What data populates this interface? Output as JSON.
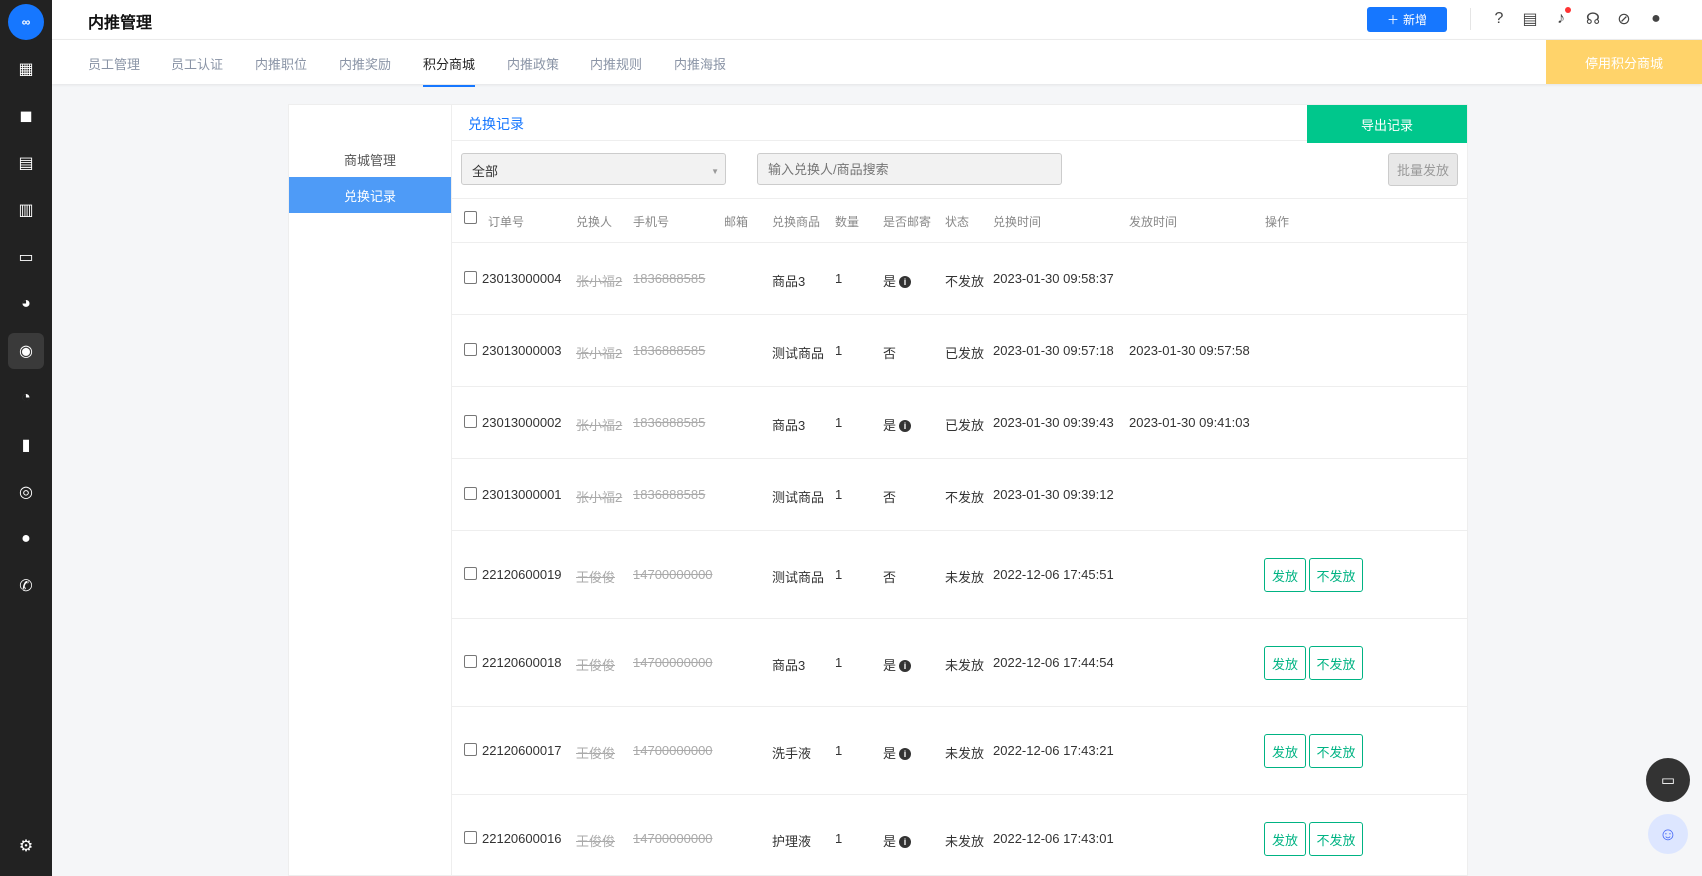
{
  "header": {
    "title": "内推管理",
    "new_label": "新增"
  },
  "tabs": [
    "员工管理",
    "员工认证",
    "内推职位",
    "内推奖励",
    "积分商城",
    "内推政策",
    "内推规则",
    "内推海报"
  ],
  "stop_label": "停用积分商城",
  "sidebar": {
    "items": [
      "商城管理",
      "兑换记录"
    ]
  },
  "panel": {
    "title": "兑换记录",
    "export_label": "导出记录",
    "filter_value": "全部",
    "search_placeholder": "输入兑换人/商品搜索",
    "batch_label": "批量发放"
  },
  "table": {
    "headers": [
      "订单号",
      "兑换人",
      "手机号",
      "邮箱",
      "兑换商品",
      "数量",
      "是否邮寄",
      "状态",
      "兑换时间",
      "发放时间",
      "操作"
    ],
    "rows": [
      {
        "order": "23013000004",
        "person": "张小福2",
        "phone": "1836888585",
        "email": "",
        "product": "商品3",
        "qty": "1",
        "mail": "是",
        "status": "不发放",
        "time": "2023-01-30 09:58:37",
        "issued": ""
      },
      {
        "order": "23013000003",
        "person": "张小福2",
        "phone": "1836888585",
        "email": "",
        "product": "测试商品",
        "qty": "1",
        "mail": "否",
        "status": "已发放",
        "time": "2023-01-30 09:57:18",
        "issued": "2023-01-30 09:57:58"
      },
      {
        "order": "23013000002",
        "person": "张小福2",
        "phone": "1836888585",
        "email": "",
        "product": "商品3",
        "qty": "1",
        "mail": "是",
        "status": "已发放",
        "time": "2023-01-30 09:39:43",
        "issued": "2023-01-30 09:41:03"
      },
      {
        "order": "23013000001",
        "person": "张小福2",
        "phone": "1836888585",
        "email": "",
        "product": "测试商品",
        "qty": "1",
        "mail": "否",
        "status": "不发放",
        "time": "2023-01-30 09:39:12",
        "issued": ""
      },
      {
        "order": "22120600019",
        "person": "王俊俊",
        "phone": "14700000000",
        "email": "",
        "product": "测试商品",
        "qty": "1",
        "mail": "否",
        "status": "未发放",
        "time": "2022-12-06 17:45:51",
        "issued": ""
      },
      {
        "order": "22120600018",
        "person": "王俊俊",
        "phone": "14700000000",
        "email": "",
        "product": "商品3",
        "qty": "1",
        "mail": "是",
        "status": "未发放",
        "time": "2022-12-06 17:44:54",
        "issued": ""
      },
      {
        "order": "22120600017",
        "person": "王俊俊",
        "phone": "14700000000",
        "email": "",
        "product": "洗手液",
        "qty": "1",
        "mail": "是",
        "status": "未发放",
        "time": "2022-12-06 17:43:21",
        "issued": ""
      },
      {
        "order": "22120600016",
        "person": "王俊俊",
        "phone": "14700000000",
        "email": "",
        "product": "护理液",
        "qty": "1",
        "mail": "是",
        "status": "未发放",
        "time": "2022-12-06 17:43:01",
        "issued": ""
      }
    ],
    "issue_label": "发放",
    "reject_label": "不发放"
  },
  "colors": {
    "primary": "#1677ff",
    "export": "#00c78c",
    "stop": "#ffd36a",
    "action": "#00b383"
  }
}
